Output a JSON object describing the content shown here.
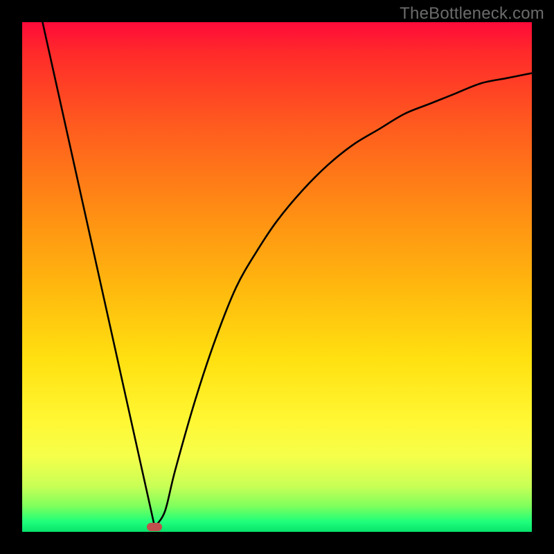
{
  "watermark": "TheBottleneck.com",
  "colors": {
    "frame": "#000000",
    "curve": "#000000",
    "marker": "#c0504d"
  },
  "chart_data": {
    "type": "line",
    "title": "",
    "xlabel": "",
    "ylabel": "",
    "x_range": [
      0,
      100
    ],
    "y_range": [
      0,
      100
    ],
    "gradient_direction": "top-to-bottom",
    "gradient_meaning": "red=high bottleneck, green=low bottleneck",
    "series": [
      {
        "name": "bottleneck-curve",
        "x": [
          4,
          8,
          12,
          16,
          20,
          24,
          26,
          28,
          30,
          34,
          38,
          42,
          46,
          50,
          55,
          60,
          65,
          70,
          75,
          80,
          85,
          90,
          95,
          100
        ],
        "y": [
          100,
          82,
          64,
          46,
          28,
          10,
          1,
          4,
          12,
          26,
          38,
          48,
          55,
          61,
          67,
          72,
          76,
          79,
          82,
          84,
          86,
          88,
          89,
          90
        ]
      }
    ],
    "marker": {
      "x": 26,
      "y": 1
    }
  }
}
